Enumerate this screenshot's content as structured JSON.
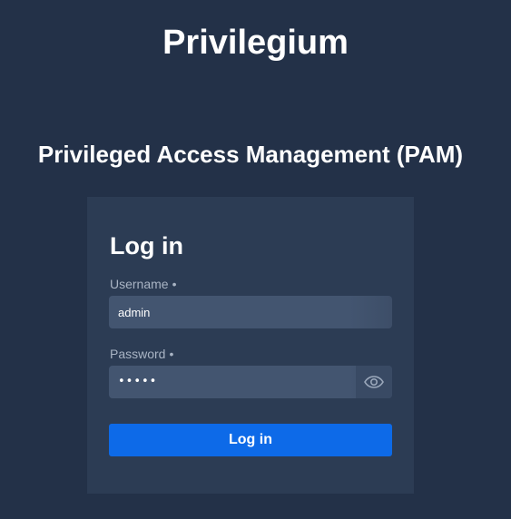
{
  "app": {
    "title": "Privilegium",
    "subtitle": "Privileged Access Management (PAM)"
  },
  "login_form": {
    "heading": "Log in",
    "username": {
      "label": "Username",
      "required_marker": "•",
      "value": "admin"
    },
    "password": {
      "label": "Password",
      "required_marker": "•",
      "masked_value": "•••••",
      "toggle_icon": "eye-icon"
    },
    "submit_label": "Log in"
  },
  "colors": {
    "background": "#233148",
    "card": "#2c3c54",
    "input": "#435570",
    "primary_button": "#0d6ae8",
    "label_text": "#a9b4c4"
  }
}
